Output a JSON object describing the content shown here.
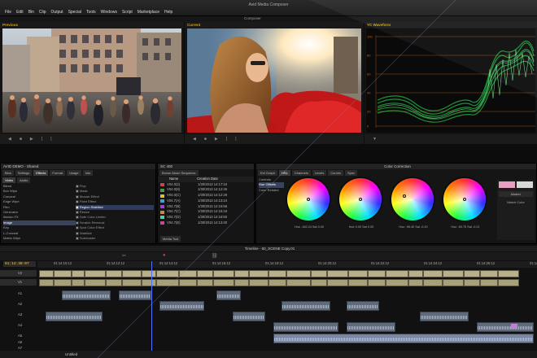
{
  "app": {
    "title": "Avid Media Composer",
    "menu": [
      "File",
      "Edit",
      "Bin",
      "Clip",
      "Output",
      "Special",
      "Tools",
      "Windows",
      "Script",
      "Marketplace",
      "Help"
    ],
    "composer_title": "Composer"
  },
  "monitors": {
    "source_label": "Previous",
    "record_label": "Current",
    "scope_label": "YC Waveform"
  },
  "bin": {
    "title": "AVID DEMO - Shared",
    "tabs": [
      "Bins",
      "Settings",
      "Effects",
      "Format",
      "Usage",
      "Info"
    ],
    "left_tabs": [
      "Video",
      "Audio"
    ],
    "categories": [
      "Blend",
      "Box Wipe",
      "Conceal",
      "Edge Wipe",
      "Film",
      "Generator",
      "Illusion FX",
      "Image",
      "Key",
      "L-Conceal",
      "Matrix Wipe"
    ],
    "selected_category": "Image",
    "effects": [
      "Flop",
      "Mask",
      "Mosaic Effect",
      "Paint Effect",
      "Region Stabilize",
      "Resize",
      "Safe Color Limiter",
      "Scratch Removal",
      "Spot Color Effect",
      "Stabilize",
      "Submaster"
    ],
    "selected_effect": "Region Stabilize"
  },
  "sequence_bin": {
    "title": "SC 400",
    "dropdown": "Brown Moon Sequence",
    "column_name": "Name",
    "column_date": "Creation Date",
    "rows": [
      {
        "name": "V04.0(2)",
        "date": "1/30/2013 14:17:34",
        "color": "#d84040"
      },
      {
        "name": "V04.0(8)",
        "date": "1/30/2013 14:12:45",
        "color": "#40a040"
      },
      {
        "name": "V04.0(C)",
        "date": "1/30/2013 14:12:28",
        "color": "#d8c040"
      },
      {
        "name": "V04.7(A)",
        "date": "1/30/2013 14:13:24",
        "color": "#40a0d8"
      },
      {
        "name": "V04.7(B)",
        "date": "1/30/2013 14:15:56",
        "color": "#a040d8"
      },
      {
        "name": "V04.7(C)",
        "date": "1/30/2013 14:15:16",
        "color": "#d88040"
      },
      {
        "name": "V04.7(D)",
        "date": "1/30/2013 14:16:50",
        "color": "#40d8a0"
      },
      {
        "name": "V04.7(E)",
        "date": "1/30/2013 14:13:40",
        "color": "#d84090"
      }
    ],
    "footer": "Media Tool"
  },
  "color_correction": {
    "title": "Color Correction",
    "tabs": [
      "Ext Graph",
      "HSL",
      "Channels",
      "Levels",
      "Curves",
      "Spec"
    ],
    "left_items": [
      "Controls",
      "Hue Offsets",
      "Color Related"
    ],
    "selected_left_item": "Hue Offsets",
    "wheel_readouts": [
      "Hue -182.24  Sat 0.00",
      "Hue 0.00  Sat 0.00",
      "Hue -98.40  Sat -0.20",
      "Hue -65.75  Sat -0.21"
    ],
    "side_label": "Match Color",
    "side_button": "Master"
  },
  "timeline": {
    "title": "Timeline - 60_SCENE Copy.01",
    "timecode": "01:14:30:07",
    "ruler": [
      "01:14:10:12",
      "01:14:12:12",
      "01:14:14:12",
      "01:14:16:12",
      "01:14:18:12",
      "01:14:20:12",
      "01:14:22:12",
      "01:14:24:12",
      "01:14:26:12",
      "01:14:28:12"
    ],
    "tracks": [
      "V2",
      "V1",
      "A1",
      "A2",
      "A3",
      "A4",
      "A5",
      "A6",
      "A7"
    ],
    "footer": "Untitled"
  },
  "scope": {
    "scale_values": [
      "100",
      "80",
      "60",
      "40",
      "20",
      "0"
    ]
  }
}
